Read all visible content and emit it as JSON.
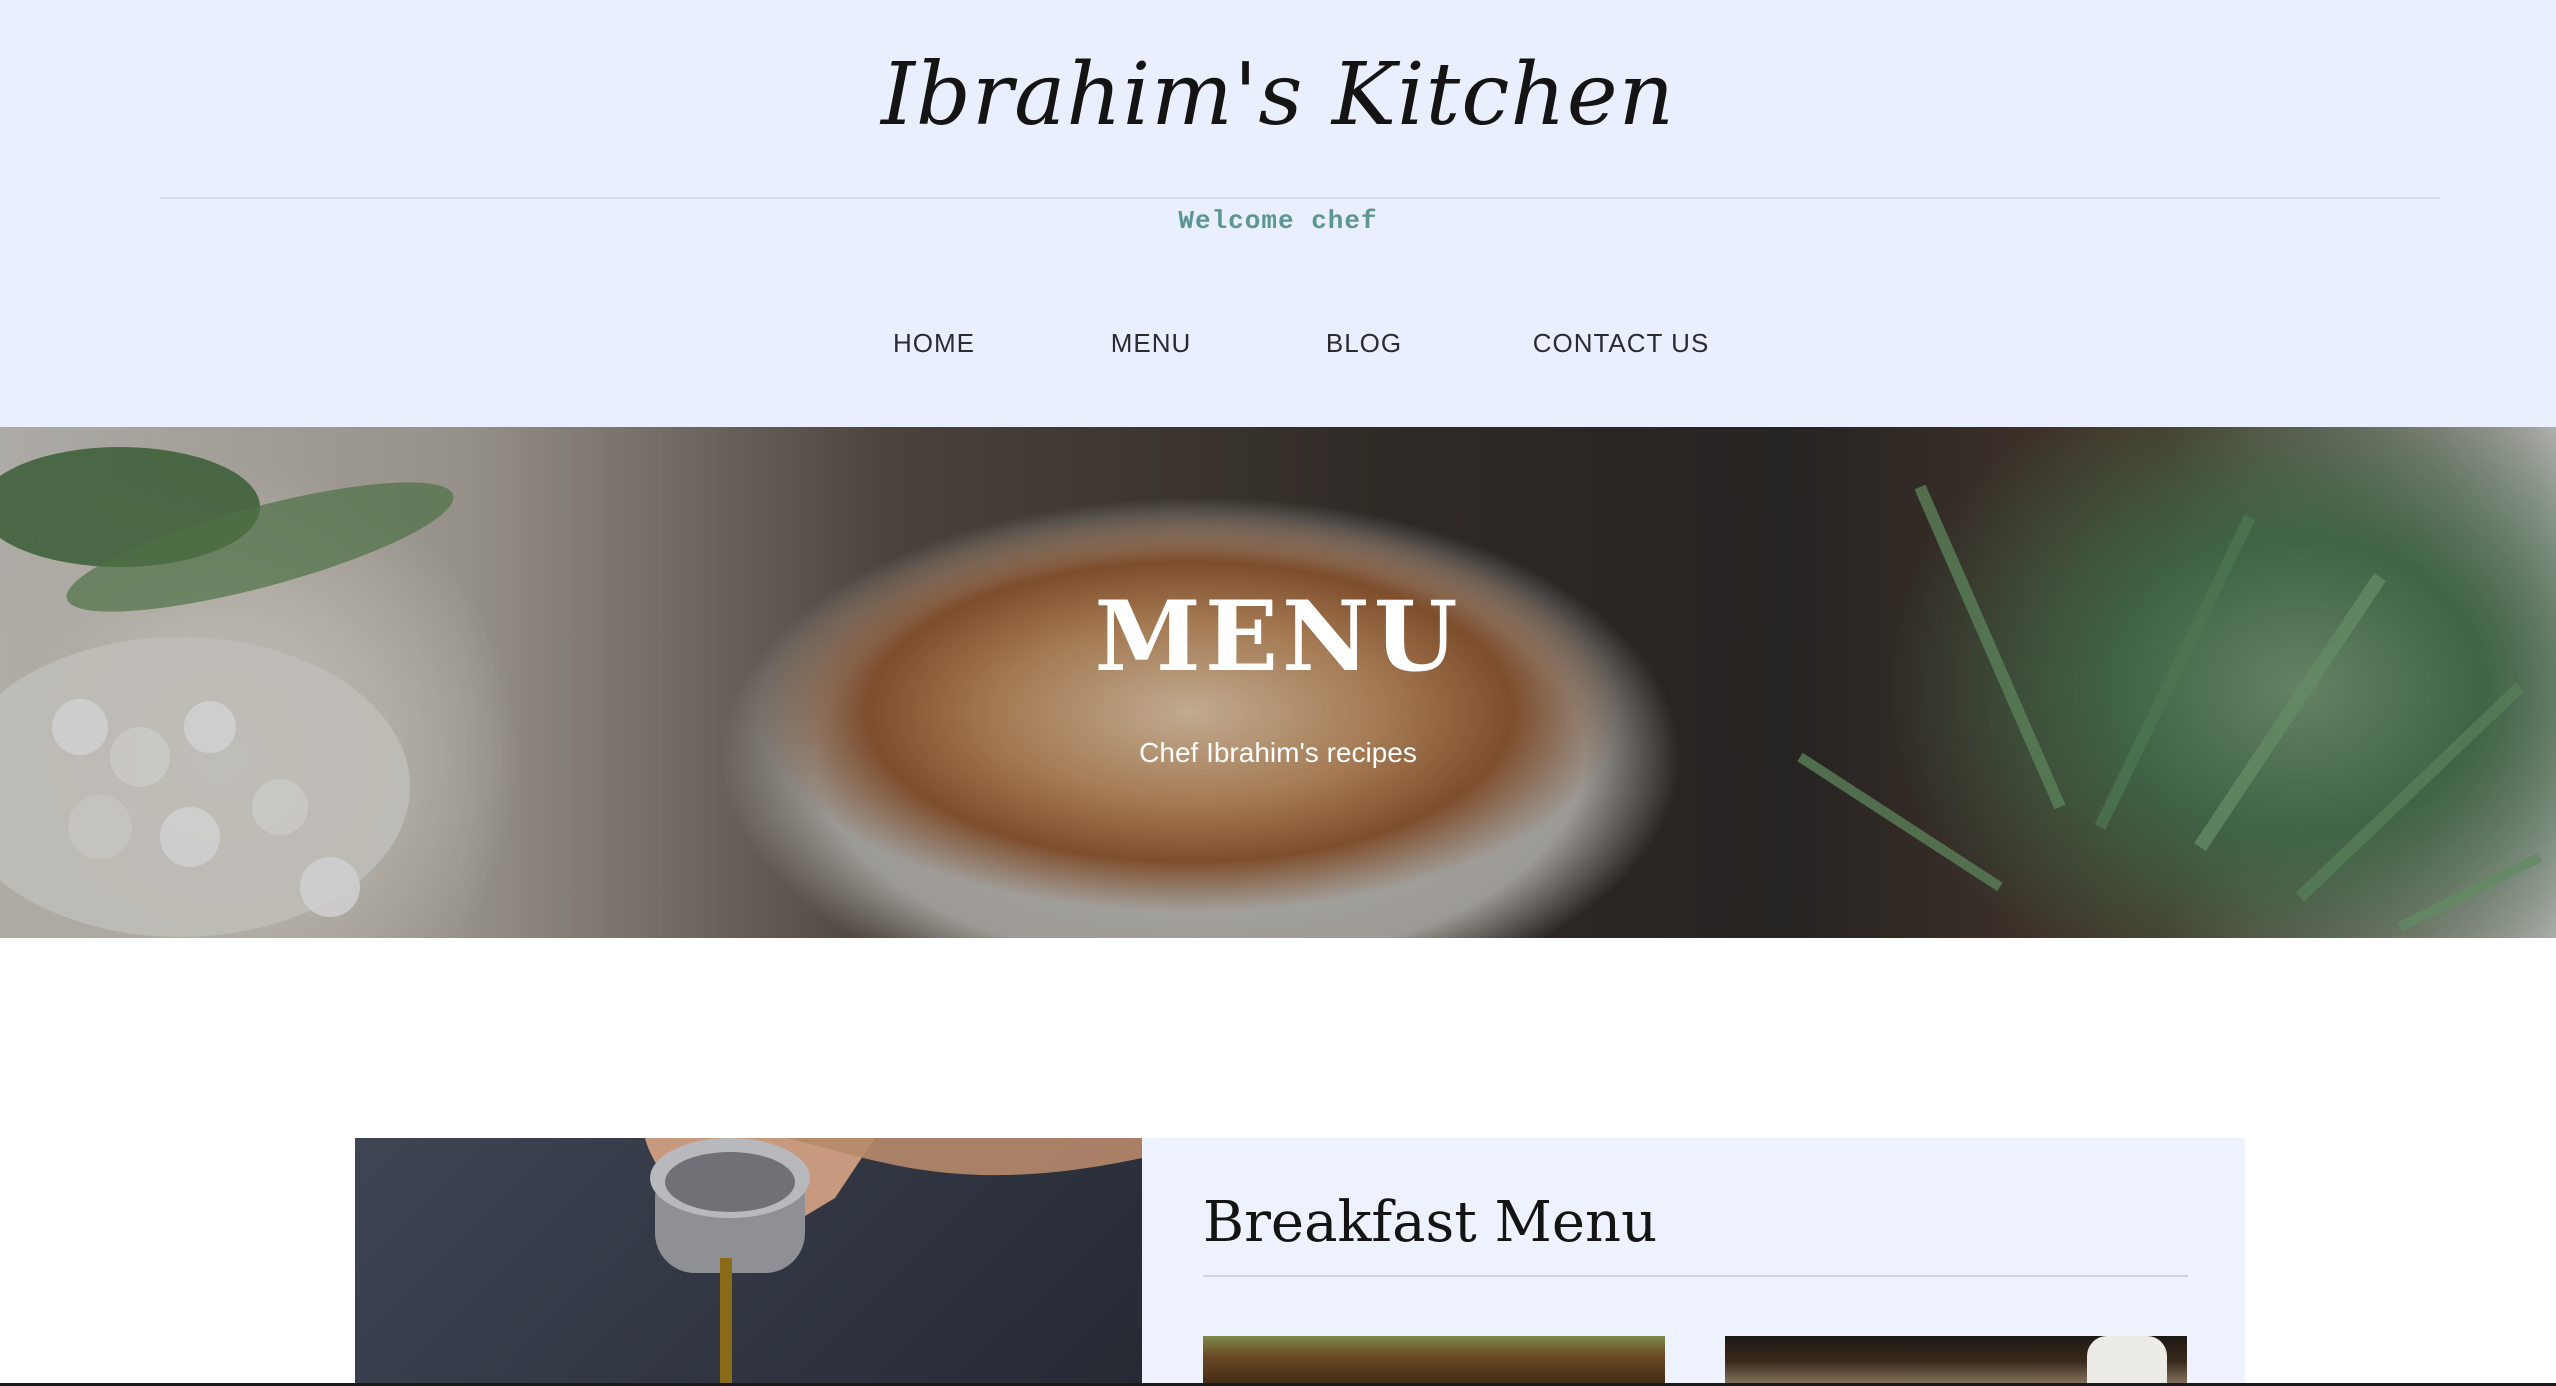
{
  "header": {
    "site_title": "Ibrahim's Kitchen",
    "welcome": "Welcome chef"
  },
  "nav": {
    "items": [
      {
        "label": "HOME"
      },
      {
        "label": "MENU"
      },
      {
        "label": "BLOG"
      },
      {
        "label": "CONTACT US"
      }
    ]
  },
  "hero": {
    "title": "MENU",
    "subtitle": "Chef Ibrahim's recipes"
  },
  "breakfast": {
    "heading": "Breakfast Menu"
  },
  "colors": {
    "header_bg": "#e9effc",
    "welcome_text": "#5c9690",
    "card_bg": "#eef2fd"
  }
}
